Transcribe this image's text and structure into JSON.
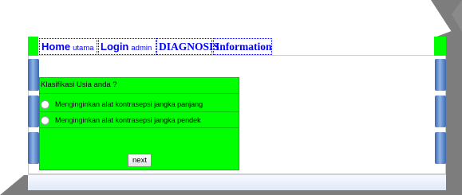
{
  "nav": {
    "items": [
      {
        "big": "Home",
        "small": "utama"
      },
      {
        "big": "Login",
        "small": "admin"
      },
      {
        "big": "DIAGNOSIS",
        "small": ""
      },
      {
        "big": "Information",
        "small": ""
      }
    ]
  },
  "form": {
    "title": "Klasifikasi Usia anda ?",
    "options": [
      {
        "label": "Menginginkan alat kontrasepsi jangka panjang"
      },
      {
        "label": "Menginginkan alat kontrasepsi jangka pendek"
      }
    ],
    "submit_label": "next"
  },
  "colors": {
    "form_bg": "#00ff00",
    "nav_text": "#0000ff",
    "nav_accent": "#00ff00",
    "background_gray": "#7a7a7a"
  }
}
